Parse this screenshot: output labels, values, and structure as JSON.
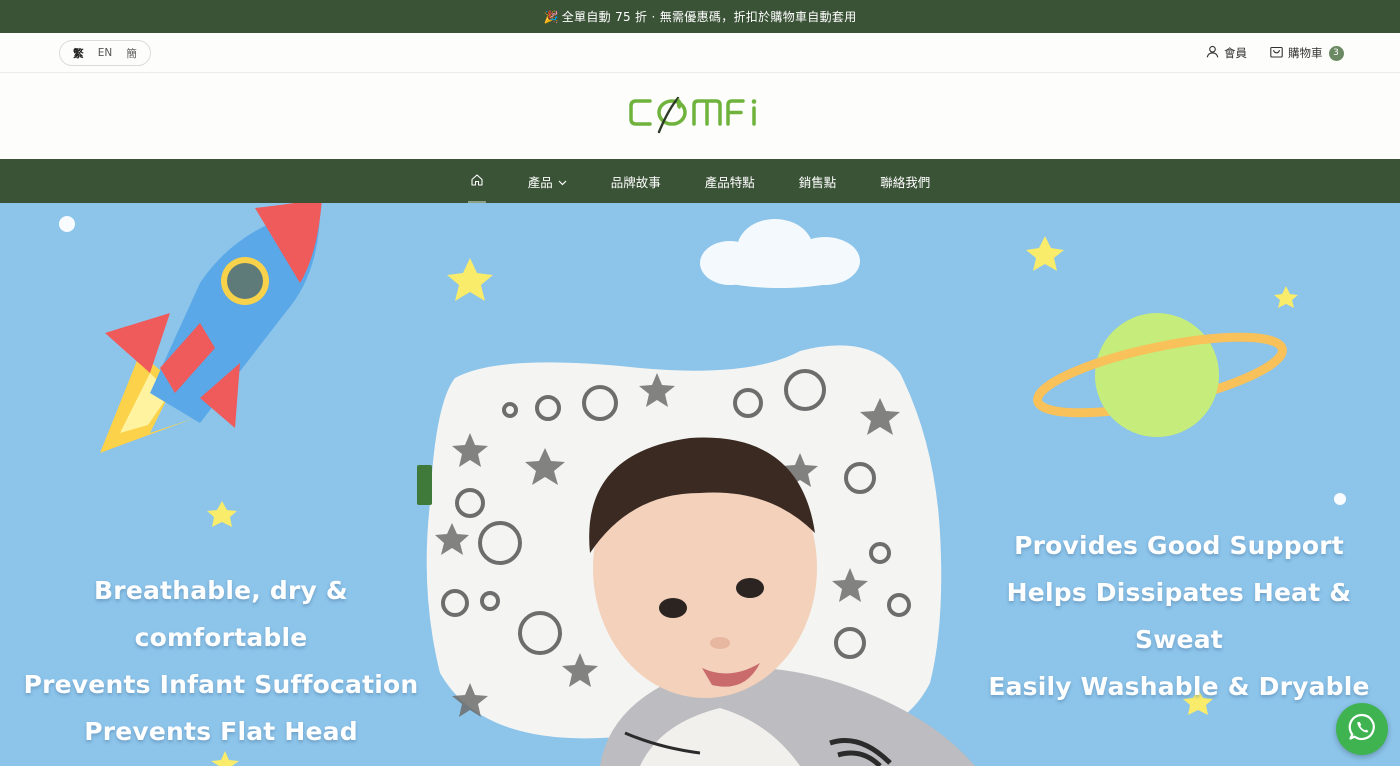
{
  "announcement": {
    "icon": "party-popper-icon",
    "text": "全單自動 75 折 · 無需優惠碼，折扣於購物車自動套用"
  },
  "languages": [
    "繁",
    "EN",
    "簡"
  ],
  "header": {
    "account_label": "會員",
    "cart_label": "購物車",
    "cart_count": "3"
  },
  "brand": {
    "logo_text": "COMFI",
    "colors": {
      "green": "#3a5236",
      "logo_green": "#6fb33d",
      "accent": "#6b8a63"
    }
  },
  "nav": {
    "home_icon": "home-icon",
    "items": [
      {
        "label": "產品",
        "has_dropdown": true
      },
      {
        "label": "品牌故事"
      },
      {
        "label": "產品特點"
      },
      {
        "label": "銷售點"
      },
      {
        "label": "聯絡我們"
      }
    ]
  },
  "hero": {
    "left_lines": [
      "Breathable, dry & comfortable",
      "Prevents Infant Suffocation",
      "Prevents Flat Head"
    ],
    "right_lines": [
      "Provides Good Support",
      "Helps Dissipates Heat & Sweat",
      "Easily Washable & Dryable"
    ],
    "background_color": "#8cc4ea"
  },
  "floating": {
    "whatsapp_icon": "whatsapp-icon"
  }
}
